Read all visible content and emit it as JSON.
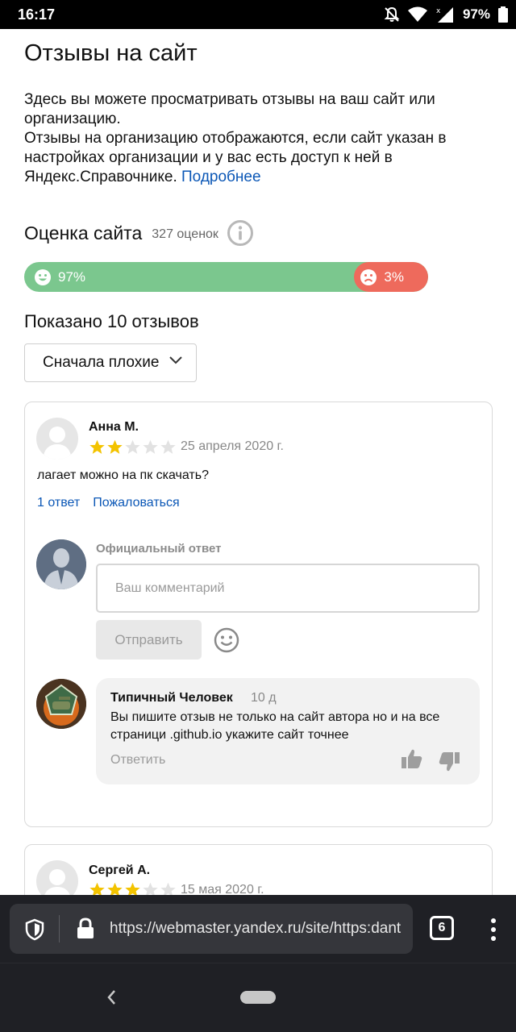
{
  "status_bar": {
    "time": "16:17",
    "battery": "97%",
    "icons": [
      "bell-off-icon",
      "wifi-icon",
      "signal-icon",
      "battery-icon"
    ]
  },
  "page": {
    "title": "Отзывы на сайт",
    "intro_line1": "Здесь вы можете просматривать отзывы на ваш сайт или организацию.",
    "intro_line2": "Отзывы на организацию отображаются, если сайт указан в настройках организации и у вас есть доступ к ней в Яндекс.Справочнике.",
    "intro_link": "Подробнее"
  },
  "rating": {
    "title": "Оценка сайта",
    "count": "327 оценок",
    "positive_label": "97%",
    "negative_label": "3%",
    "positive_fraction": 0.97,
    "colors": {
      "positive": "#7bc78e",
      "negative": "#ee6a5c"
    }
  },
  "reviews_summary": {
    "shown": "Показано 10 отзывов",
    "sort_selected": "Сначала плохие"
  },
  "reviews": [
    {
      "author": "Анна М.",
      "stars": 2,
      "date": "25 апреля 2020 г.",
      "text": "лагает можно на пк скачать?",
      "replies_link": "1 ответ",
      "report_link": "Пожаловаться",
      "official": {
        "label": "Официальный ответ",
        "placeholder": "Ваш комментарий",
        "send_label": "Отправить"
      },
      "reply": {
        "author": "Типичный Человек",
        "age": "10 д",
        "text": "Вы пишите отзыв не только на сайт автора но и на все страници .github.io укажите сайт точнее",
        "answer_label": "Ответить"
      }
    },
    {
      "author": "Сергей А.",
      "stars": 3,
      "date": "15 мая 2020 г."
    }
  ],
  "browser": {
    "url": "https://webmaster.yandex.ru/site/https:dant",
    "tabs_count": "6"
  }
}
